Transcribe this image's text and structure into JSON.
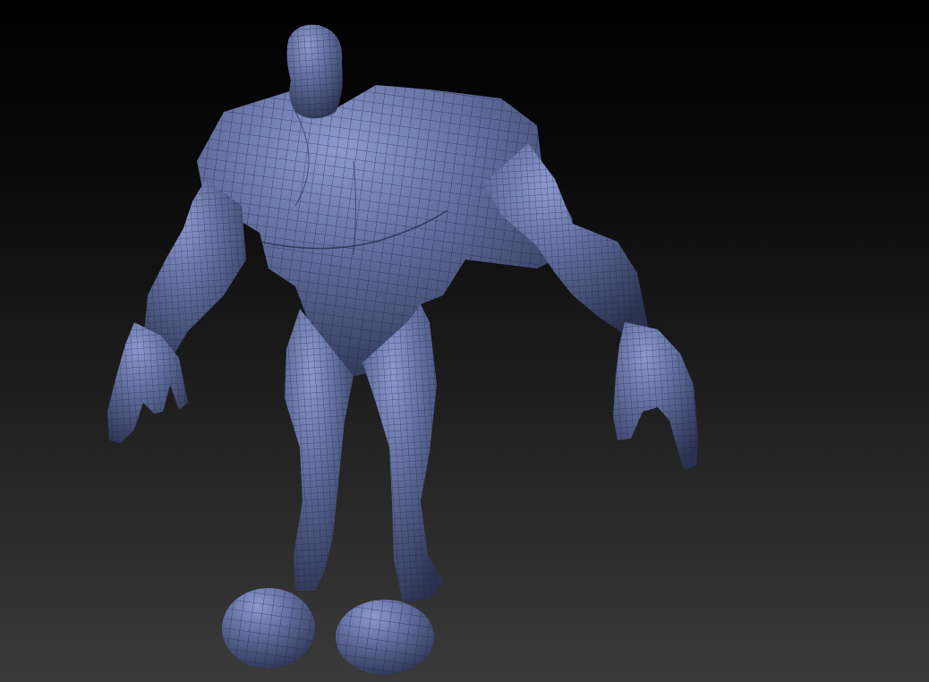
{
  "viewport": {
    "background": {
      "top": "#000000",
      "bottom": "#3a3a3a"
    },
    "model": {
      "subject": "humanoid-figure",
      "base_color": "#5f6c9c",
      "highlight_color": "#8d9ad0",
      "shadow_color": "#2c3352",
      "wire_color": "#1b2036"
    }
  }
}
